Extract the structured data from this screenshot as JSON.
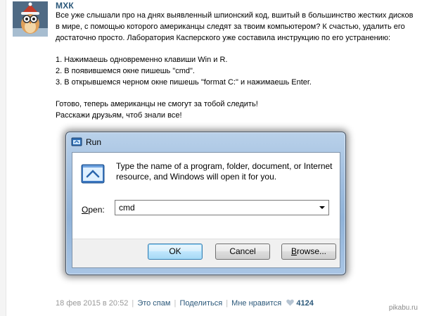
{
  "post": {
    "author": "МХК",
    "paragraphs": [
      "Все уже слышали про на днях выявленный шпионский код, вшитый в большинство жестких дисков в мире, с помощью которого американцы следят за твоим компьютером? К счастью, удалить его достаточно просто. Лаборатория Касперского уже составила инструкцию по его устранению:"
    ],
    "steps": [
      "1. Нажимаешь одновременно клавиши Win и R.",
      "2. В появившемся окне пишешь \"cmd\".",
      "3. В открывшемся черном окне пишешь \"format C:\" и нажимаешь Enter."
    ],
    "closing": [
      "Готово, теперь американцы не смогут за тобой следить!",
      "Расскажи друзьям, чтоб знали все!"
    ]
  },
  "run_dialog": {
    "title": "Run",
    "description": "Type the name of a program, folder, document, or Internet resource, and Windows will open it for you.",
    "open_label_accel": "O",
    "open_label_rest": "pen:",
    "open_value": "cmd",
    "ok_label": "OK",
    "cancel_label": "Cancel",
    "browse_accel": "B",
    "browse_rest": "rowse..."
  },
  "footer": {
    "date": "18 фев 2015 в 20:52",
    "spam": "Это спам",
    "share": "Поделиться",
    "like": "Мне нравится",
    "like_count": "4124"
  },
  "watermark": "pikabu.ru",
  "icons": {
    "avatar": "owl-avatar",
    "window": "run-icon",
    "heart": "heart-icon"
  },
  "colors": {
    "link": "#2b587a",
    "muted": "#999999"
  }
}
